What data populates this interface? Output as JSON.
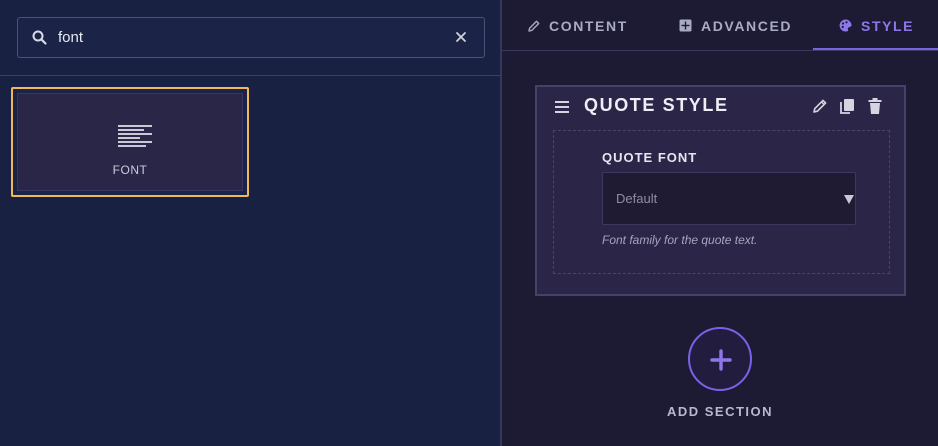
{
  "search": {
    "value": "font",
    "placeholder": ""
  },
  "widgets": [
    {
      "label": "FONT",
      "icon": "text-align-left-icon"
    }
  ],
  "tabs": [
    {
      "label": "CONTENT",
      "icon": "pencil-icon"
    },
    {
      "label": "ADVANCED",
      "icon": "grid-plus-icon"
    },
    {
      "label": "STYLE",
      "icon": "palette-icon",
      "active": true
    }
  ],
  "section": {
    "title": "QUOTE STYLE",
    "field": {
      "label": "QUOTE FONT",
      "value": "Default",
      "help": "Font family for the quote text."
    }
  },
  "add_section": {
    "label": "ADD SECTION"
  },
  "colors": {
    "accent": "#7b61e8",
    "selection_border": "#f2b857",
    "left_bg": "#182142",
    "right_bg": "#1d1a33"
  }
}
